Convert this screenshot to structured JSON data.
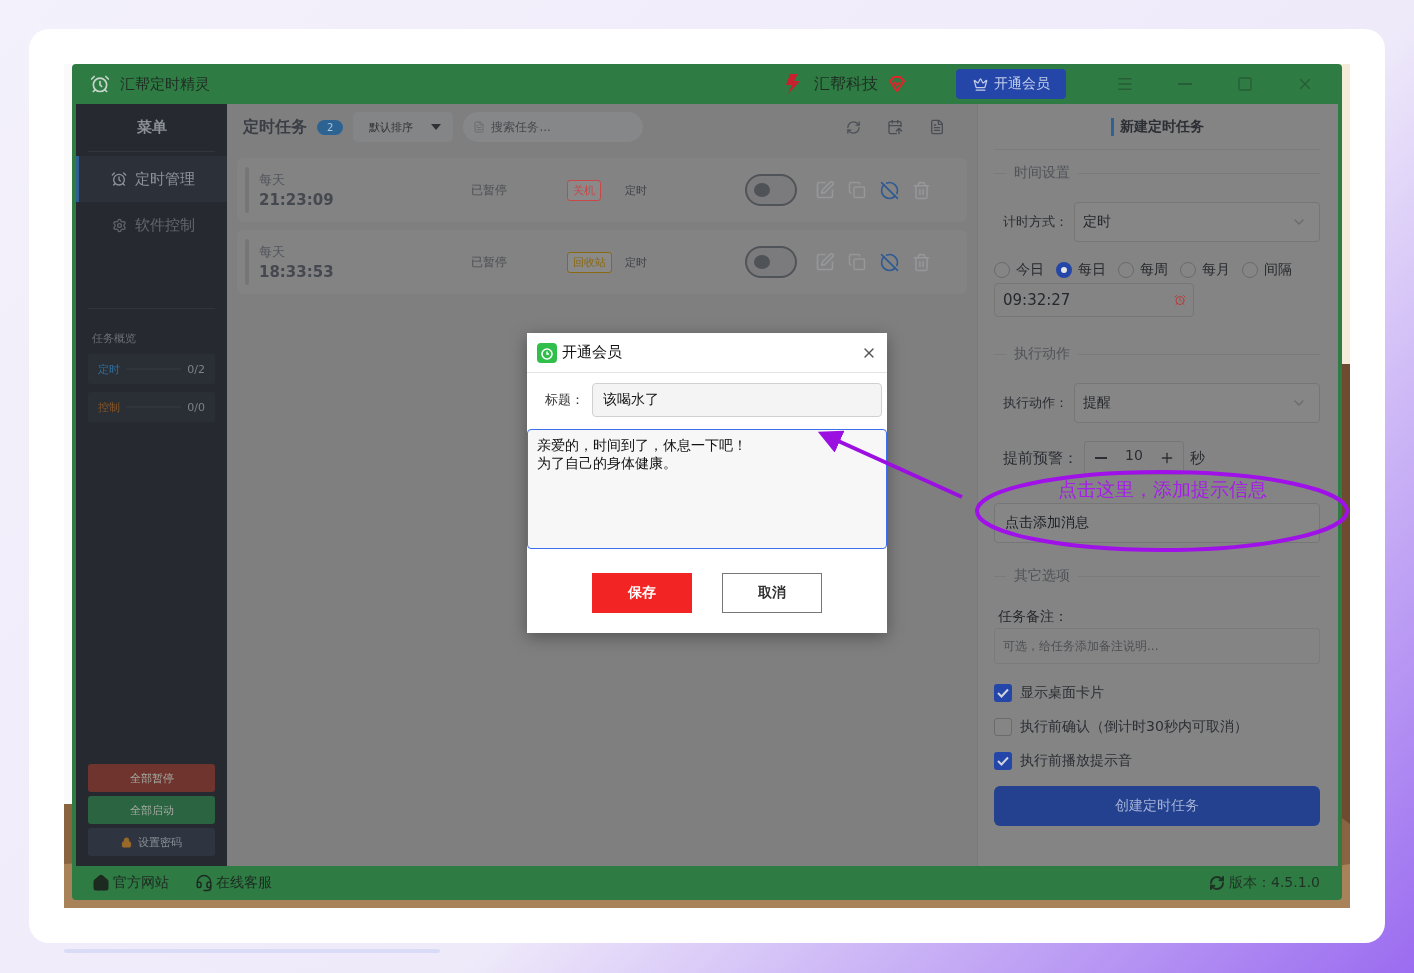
{
  "window": {
    "title": "汇帮定时精灵",
    "brand": "汇帮科技",
    "vip_button": "开通会员"
  },
  "sidebar": {
    "heading": "菜单",
    "items": [
      {
        "label": "定时管理",
        "selected": true
      },
      {
        "label": "软件控制",
        "selected": false
      }
    ],
    "overview_title": "任务概览",
    "overview": [
      {
        "label": "定时",
        "count": "0/2",
        "color": "#2f6e9e"
      },
      {
        "label": "控制",
        "count": "0/0",
        "color": "#8a5524"
      }
    ],
    "buttons": [
      {
        "label": "全部暂停",
        "kind": "danger"
      },
      {
        "label": "全部启动",
        "kind": "success"
      },
      {
        "label": "设置密码",
        "kind": "lock"
      }
    ]
  },
  "task_list": {
    "title": "定时任务",
    "count": "2",
    "sort": "默认排序",
    "search_placeholder": "搜索任务...",
    "tasks": [
      {
        "repeat": "每天",
        "time": "21:23:09",
        "status": "已暂停",
        "tag": "关机",
        "color": "#c84848",
        "type": "定时",
        "on": false
      },
      {
        "repeat": "每天",
        "time": "18:33:53",
        "status": "已暂停",
        "tag": "回收站",
        "color": "#8a6a10",
        "type": "定时",
        "on": false
      }
    ]
  },
  "form": {
    "title": "新建定时任务",
    "time_section": "时间设置",
    "mode_label": "计时方式：",
    "mode_value": "定时",
    "repeat_options": [
      {
        "label": "今日",
        "selected": false
      },
      {
        "label": "每日",
        "selected": true
      },
      {
        "label": "每周",
        "selected": false
      },
      {
        "label": "每月",
        "selected": false
      },
      {
        "label": "间隔",
        "selected": false
      }
    ],
    "time_value": "09:32:27",
    "action_section": "执行动作",
    "action_label": "执行动作：",
    "action_value": "提醒",
    "warn_label": "提前预警：",
    "warn_value": "10",
    "warn_unit": "秒",
    "message_value": "点击添加消息",
    "other_section": "其它选项",
    "note_label": "任务备注：",
    "note_placeholder": "可选，给任务添加备注说明...",
    "options": [
      {
        "label": "显示桌面卡片",
        "checked": true
      },
      {
        "label": "执行前确认（倒计时30秒内可取消）",
        "checked": false
      },
      {
        "label": "执行前播放提示音",
        "checked": true
      }
    ],
    "submit": "创建定时任务"
  },
  "footer": {
    "links": [
      "官方网站",
      "在线客服"
    ],
    "version": "版本：4.5.1.0"
  },
  "dialog": {
    "title": "开通会员",
    "title_label": "标题：",
    "title_value": "该喝水了",
    "message_lines": [
      "亲爱的，时间到了，休息一下吧！",
      "为了自己的身体健康。"
    ],
    "save": "保存",
    "cancel": "取消"
  },
  "annotation": {
    "text": "点击这里，添加提示信息"
  }
}
